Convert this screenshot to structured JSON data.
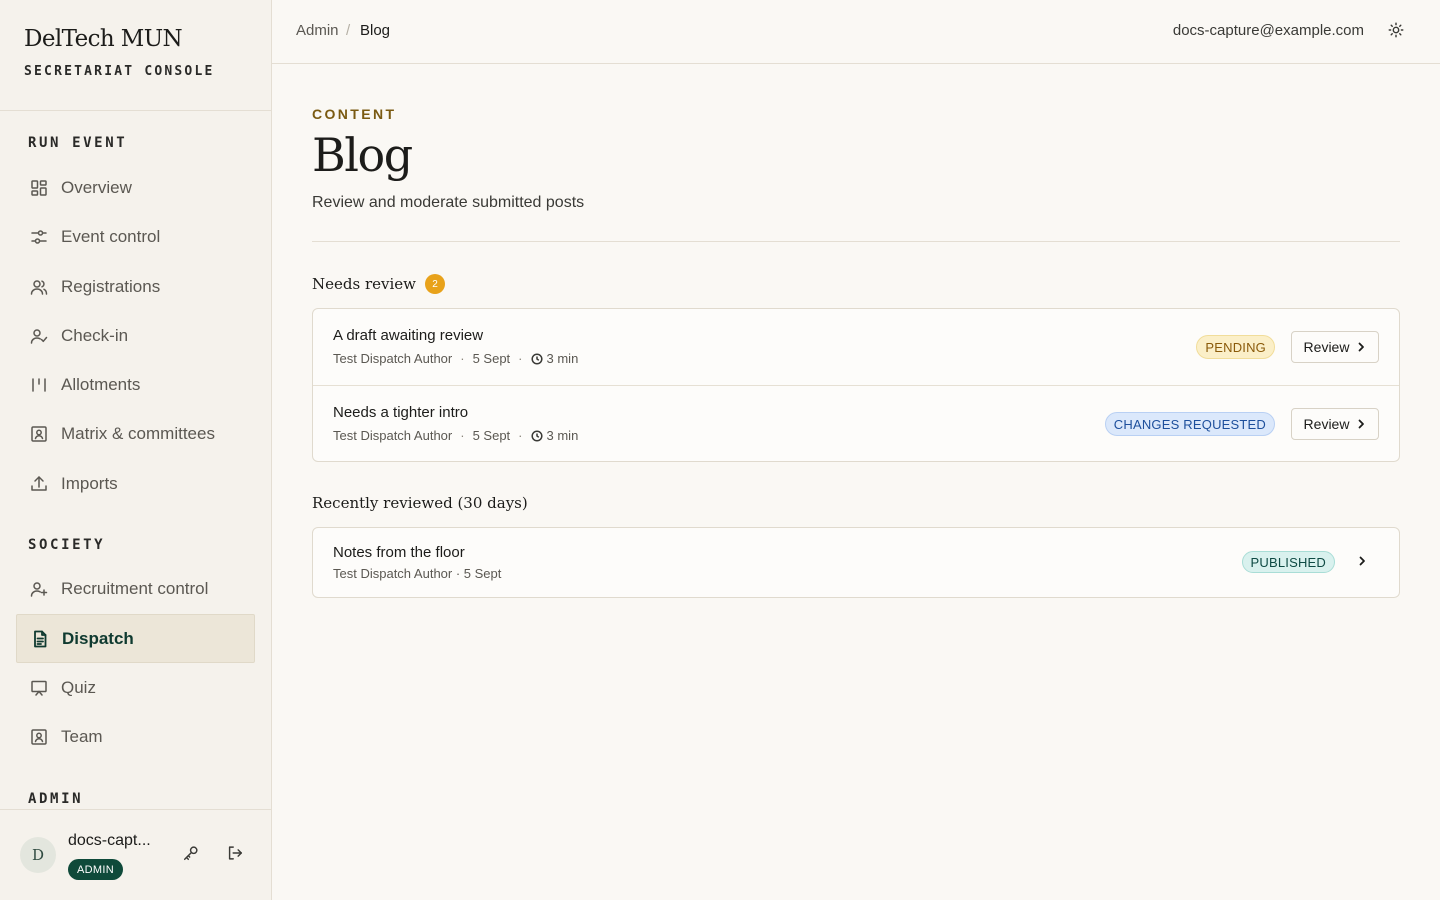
{
  "brand": {
    "name": "DelTech MUN",
    "subtitle": "SECRETARIAT CONSOLE"
  },
  "sidebar": {
    "sections": [
      {
        "title": "RUN EVENT",
        "items": [
          {
            "label": "Overview",
            "icon": "grid-icon"
          },
          {
            "label": "Event control",
            "icon": "sliders-icon"
          },
          {
            "label": "Registrations",
            "icon": "users-icon"
          },
          {
            "label": "Check-in",
            "icon": "user-check-icon"
          },
          {
            "label": "Allotments",
            "icon": "columns-icon"
          },
          {
            "label": "Matrix & committees",
            "icon": "id-card-icon"
          },
          {
            "label": "Imports",
            "icon": "upload-icon"
          }
        ]
      },
      {
        "title": "SOCIETY",
        "items": [
          {
            "label": "Recruitment control",
            "icon": "user-plus-icon"
          },
          {
            "label": "Dispatch",
            "icon": "document-icon",
            "active": true
          },
          {
            "label": "Quiz",
            "icon": "presentation-icon"
          },
          {
            "label": "Team",
            "icon": "id-card-icon"
          }
        ]
      },
      {
        "title": "ADMIN",
        "items": []
      }
    ]
  },
  "user": {
    "initial": "D",
    "name": "docs-capt...",
    "role": "ADMIN",
    "email": "docs-capture@example.com"
  },
  "breadcrumb": {
    "root": "Admin",
    "separator": "/",
    "current": "Blog"
  },
  "page": {
    "eyebrow": "CONTENT",
    "title": "Blog",
    "subtitle": "Review and moderate submitted posts"
  },
  "needs_review": {
    "heading": "Needs review",
    "count": "2",
    "posts": [
      {
        "title": "A draft awaiting review",
        "author": "Test Dispatch Author",
        "date": "5 Sept",
        "read_time": "3 min",
        "status": "PENDING",
        "action": "Review"
      },
      {
        "title": "Needs a tighter intro",
        "author": "Test Dispatch Author",
        "date": "5 Sept",
        "read_time": "3 min",
        "status": "CHANGES REQUESTED",
        "action": "Review"
      }
    ]
  },
  "recently_reviewed": {
    "heading": "Recently reviewed (30 days)",
    "posts": [
      {
        "title": "Notes from the floor",
        "meta": "Test Dispatch Author · 5 Sept",
        "status": "PUBLISHED"
      }
    ]
  },
  "colors": {
    "accent": "#0f3a30",
    "eyebrow": "#7a5a12",
    "count_badge": "#e8a21a",
    "pending": "#fbefc8",
    "changes_requested": "#dbe8fb",
    "published": "#d9f1ee"
  }
}
